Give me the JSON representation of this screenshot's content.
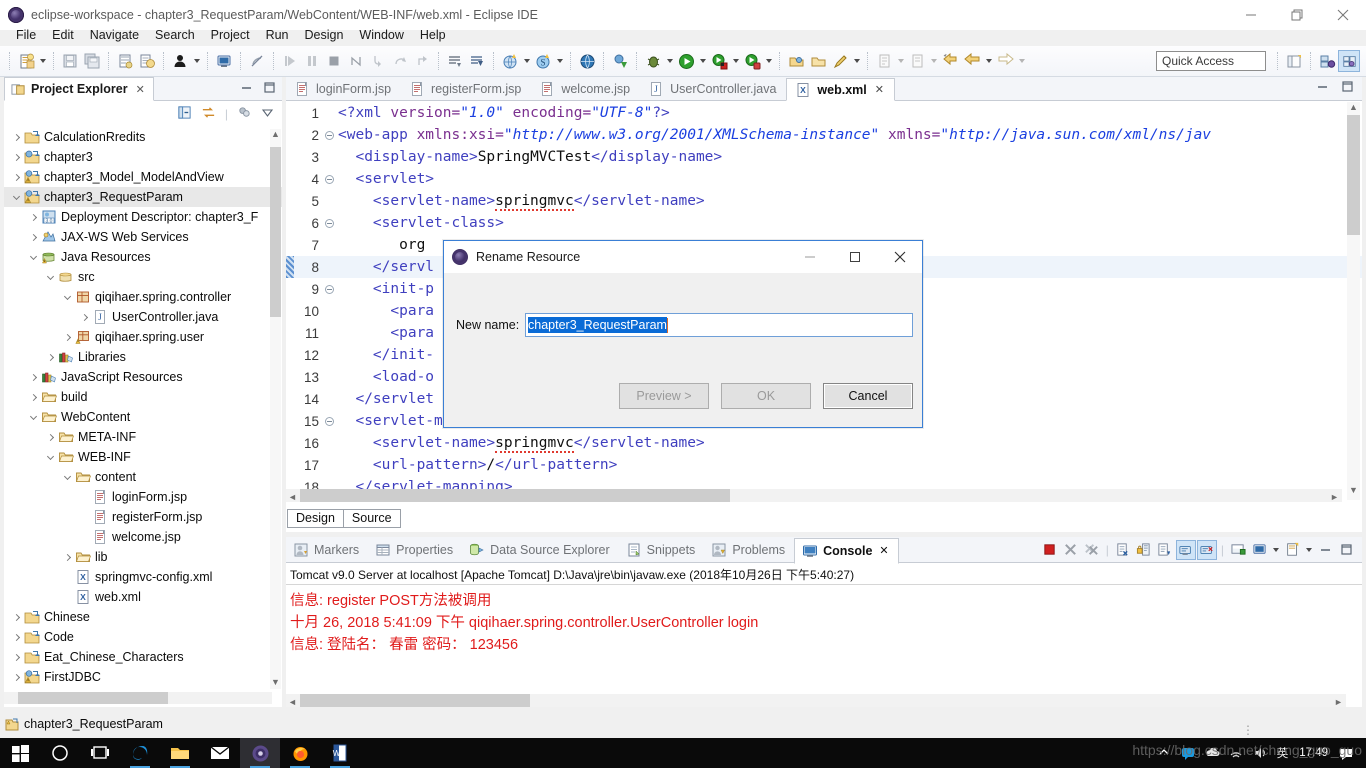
{
  "window": {
    "title": "eclipse-workspace - chapter3_RequestParam/WebContent/WEB-INF/web.xml - Eclipse IDE",
    "minimize": "—",
    "maximize": "❐",
    "close": "✕"
  },
  "menubar": {
    "items": [
      "File",
      "Edit",
      "Navigate",
      "Search",
      "Project",
      "Run",
      "Design",
      "Window",
      "Help"
    ]
  },
  "toolbar": {
    "quick_access": "Quick Access"
  },
  "explorer": {
    "tab_label": "Project Explorer",
    "close": "✕",
    "tree": [
      {
        "label": "CalculationRredits",
        "indent": 0,
        "twisty": "collapsed",
        "icon": "project-icon"
      },
      {
        "label": "chapter3",
        "indent": 0,
        "twisty": "collapsed",
        "icon": "web-project-icon"
      },
      {
        "label": "chapter3_Model_ModelAndView",
        "indent": 0,
        "twisty": "collapsed",
        "icon": "web-project-warn-icon"
      },
      {
        "label": "chapter3_RequestParam",
        "indent": 0,
        "twisty": "expanded",
        "icon": "web-project-warn-icon",
        "selected": true
      },
      {
        "label": "Deployment Descriptor: chapter3_F",
        "indent": 1,
        "twisty": "collapsed",
        "icon": "deployment-descriptor-icon"
      },
      {
        "label": "JAX-WS Web Services",
        "indent": 1,
        "twisty": "collapsed",
        "icon": "jaxws-icon"
      },
      {
        "label": "Java Resources",
        "indent": 1,
        "twisty": "expanded",
        "icon": "java-resources-icon"
      },
      {
        "label": "src",
        "indent": 2,
        "twisty": "expanded",
        "icon": "source-folder-icon"
      },
      {
        "label": "qiqihaer.spring.controller",
        "indent": 3,
        "twisty": "expanded",
        "icon": "package-icon"
      },
      {
        "label": "UserController.java",
        "indent": 4,
        "twisty": "collapsed",
        "icon": "java-file-icon"
      },
      {
        "label": "qiqihaer.spring.user",
        "indent": 3,
        "twisty": "collapsed",
        "icon": "package-warn-icon"
      },
      {
        "label": "Libraries",
        "indent": 2,
        "twisty": "collapsed",
        "icon": "libraries-icon"
      },
      {
        "label": "JavaScript Resources",
        "indent": 1,
        "twisty": "collapsed",
        "icon": "libraries-icon"
      },
      {
        "label": "build",
        "indent": 1,
        "twisty": "collapsed",
        "icon": "folder-icon"
      },
      {
        "label": "WebContent",
        "indent": 1,
        "twisty": "expanded",
        "icon": "folder-icon"
      },
      {
        "label": "META-INF",
        "indent": 2,
        "twisty": "collapsed",
        "icon": "folder-icon"
      },
      {
        "label": "WEB-INF",
        "indent": 2,
        "twisty": "expanded",
        "icon": "folder-icon"
      },
      {
        "label": "content",
        "indent": 3,
        "twisty": "expanded",
        "icon": "folder-icon"
      },
      {
        "label": "loginForm.jsp",
        "indent": 4,
        "twisty": "none",
        "icon": "jsp-file-icon"
      },
      {
        "label": "registerForm.jsp",
        "indent": 4,
        "twisty": "none",
        "icon": "jsp-file-icon"
      },
      {
        "label": "welcome.jsp",
        "indent": 4,
        "twisty": "none",
        "icon": "jsp-file-icon"
      },
      {
        "label": "lib",
        "indent": 3,
        "twisty": "collapsed",
        "icon": "folder-icon"
      },
      {
        "label": "springmvc-config.xml",
        "indent": 3,
        "twisty": "none",
        "icon": "xml-file-icon"
      },
      {
        "label": "web.xml",
        "indent": 3,
        "twisty": "none",
        "icon": "xml-file-icon"
      },
      {
        "label": "Chinese",
        "indent": 0,
        "twisty": "collapsed",
        "icon": "project-icon"
      },
      {
        "label": "Code",
        "indent": 0,
        "twisty": "collapsed",
        "icon": "project-icon"
      },
      {
        "label": "Eat_Chinese_Characters",
        "indent": 0,
        "twisty": "collapsed",
        "icon": "project-icon"
      },
      {
        "label": "FirstJDBC",
        "indent": 0,
        "twisty": "collapsed",
        "icon": "web-project-warn-icon"
      }
    ]
  },
  "editor": {
    "tabs": [
      {
        "label": "loginForm.jsp",
        "icon": "jsp-file-icon",
        "active": false
      },
      {
        "label": "registerForm.jsp",
        "icon": "jsp-file-icon",
        "active": false
      },
      {
        "label": "welcome.jsp",
        "icon": "jsp-file-icon",
        "active": false
      },
      {
        "label": "UserController.java",
        "icon": "java-file-icon",
        "active": false
      },
      {
        "label": "web.xml",
        "icon": "xml-file-icon",
        "active": true,
        "close": "✕"
      }
    ],
    "lines": [
      {
        "n": "1",
        "fold": false,
        "html": "<span class='tag'>&lt;?xml</span> <span class='attr'>version=</span><span class='val'>\"1.0\"</span> <span class='attr'>encoding=</span><span class='val'>\"UTF-8\"</span><span class='tag'>?&gt;</span>"
      },
      {
        "n": "2",
        "fold": true,
        "html": "<span class='tag'>&lt;web-app</span> <span class='attr'>xmlns:xsi=</span><span class='val'>\"http://www.w3.org/2001/XMLSchema-instance\"</span> <span class='attr'>xmlns=</span><span class='val'>\"http://java.sun.com/xml/ns/jav</span>"
      },
      {
        "n": "3",
        "fold": false,
        "html": "  <span class='tag'>&lt;display-name&gt;</span><span class='txt'>SpringMVCTest</span><span class='tag'>&lt;/display-name&gt;</span>"
      },
      {
        "n": "4",
        "fold": true,
        "html": "  <span class='tag'>&lt;servlet&gt;</span>"
      },
      {
        "n": "5",
        "fold": false,
        "html": "    <span class='tag'>&lt;servlet-name&gt;</span><span class='txt spellerr'>springmvc</span><span class='tag'>&lt;/servlet-name&gt;</span>"
      },
      {
        "n": "6",
        "fold": true,
        "html": "    <span class='tag'>&lt;servlet-class&gt;</span>"
      },
      {
        "n": "7",
        "fold": false,
        "html": "       <span class='txt'>org</span>"
      },
      {
        "n": "8",
        "fold": false,
        "hl": true,
        "mark": true,
        "html": "    <span class='tag'>&lt;/servl</span>"
      },
      {
        "n": "9",
        "fold": true,
        "html": "    <span class='tag'>&lt;init-p</span>"
      },
      {
        "n": "10",
        "fold": false,
        "html": "      <span class='tag'>&lt;para</span>"
      },
      {
        "n": "11",
        "fold": false,
        "html": "      <span class='tag'>&lt;para</span>"
      },
      {
        "n": "12",
        "fold": false,
        "html": "    <span class='tag'>&lt;/init-</span>"
      },
      {
        "n": "13",
        "fold": false,
        "html": "    <span class='tag'>&lt;load-o</span>"
      },
      {
        "n": "14",
        "fold": false,
        "html": "  <span class='tag'>&lt;/servlet</span>"
      },
      {
        "n": "15",
        "fold": true,
        "html": "  <span class='tag'>&lt;servlet-mapping&gt;</span>"
      },
      {
        "n": "16",
        "fold": false,
        "html": "    <span class='tag'>&lt;servlet-name&gt;</span><span class='txt spellerr'>springmvc</span><span class='tag'>&lt;/servlet-name&gt;</span>"
      },
      {
        "n": "17",
        "fold": false,
        "html": "    <span class='tag'>&lt;url-pattern&gt;</span><span class='txt'>/</span><span class='tag'>&lt;/url-pattern&gt;</span>"
      },
      {
        "n": "18",
        "fold": false,
        "html": "  <span class='tag'>&lt;/servlet-mapping&gt;</span>"
      }
    ],
    "footer_tabs": [
      "Design",
      "Source"
    ],
    "footer_selected": "Source"
  },
  "dialog": {
    "title": "Rename Resource",
    "minimize": "—",
    "maximize": "❐",
    "close": "✕",
    "field_label": "New name:",
    "field_value": "chapter3_RequestParam",
    "buttons": [
      {
        "label": "Preview >",
        "enabled": false
      },
      {
        "label": "OK",
        "enabled": false
      },
      {
        "label": "Cancel",
        "enabled": true
      }
    ]
  },
  "bottom_panel": {
    "tabs": [
      {
        "label": "Markers",
        "icon": "markers-icon",
        "active": false
      },
      {
        "label": "Properties",
        "icon": "properties-icon",
        "active": false
      },
      {
        "label": "Data Source Explorer",
        "icon": "datasource-icon",
        "active": false
      },
      {
        "label": "Snippets",
        "icon": "snippets-icon",
        "active": false
      },
      {
        "label": "Problems",
        "icon": "problems-icon",
        "active": false
      },
      {
        "label": "Console",
        "icon": "console-icon",
        "active": true,
        "close": "✕"
      }
    ],
    "console_header": "Tomcat v9.0 Server at localhost [Apache Tomcat] D:\\Java\\jre\\bin\\javaw.exe (2018年10月26日 下午5:40:27)",
    "console_lines": [
      "信息: register  POST方法被调用",
      "十月 26, 2018 5:41:09 下午 qiqihaer.spring.controller.UserController login",
      "信息: 登陆名： 春雷 密码： 123456"
    ],
    "console_text_color": "#e01b1b"
  },
  "statusbar": {
    "label": "chapter3_RequestParam"
  },
  "taskbar": {
    "items": [
      "start-icon",
      "cortana-icon",
      "task-view-icon",
      "edge-icon",
      "file-explorer-icon",
      "mail-icon",
      "eclipse-icon",
      "firefox-icon",
      "word-icon"
    ],
    "tray": [
      "show-hidden-icon",
      "input-method-icon",
      "onedrive-icon",
      "network-icon",
      "volume-icon"
    ],
    "ime_label": "英",
    "clock": "17:49"
  },
  "watermark": "https://blog.csdn.net/cheng_guo_guo"
}
